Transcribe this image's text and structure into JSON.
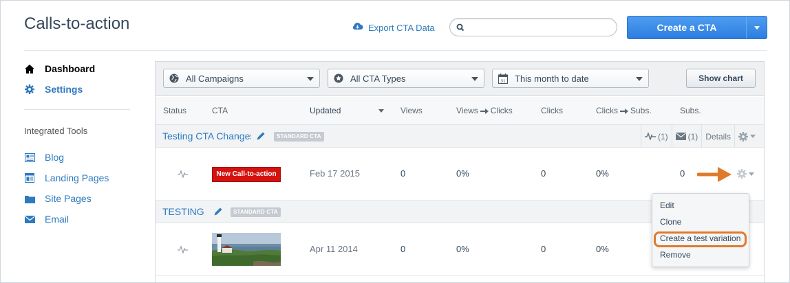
{
  "page": {
    "title": "Calls-to-action"
  },
  "header": {
    "export_label": "Export CTA Data",
    "search": {
      "value": "",
      "placeholder": ""
    },
    "create_label": "Create a CTA"
  },
  "sidebar": {
    "nav": [
      {
        "label": "Dashboard",
        "icon": "home-icon"
      },
      {
        "label": "Settings",
        "icon": "gear-icon"
      }
    ],
    "tools_heading": "Integrated Tools",
    "tools": [
      {
        "label": "Blog",
        "icon": "blog-icon"
      },
      {
        "label": "Landing Pages",
        "icon": "landing-pages-icon"
      },
      {
        "label": "Site Pages",
        "icon": "site-pages-icon"
      },
      {
        "label": "Email",
        "icon": "email-icon"
      }
    ]
  },
  "filters": {
    "campaigns": "All Campaigns",
    "types": "All CTA Types",
    "date": "This month to date",
    "show_chart": "Show chart"
  },
  "table": {
    "columns": [
      "Status",
      "CTA",
      "Updated",
      "Views",
      "Views",
      "Clicks",
      "Clicks",
      "Clicks",
      "Subs.",
      "Subs."
    ],
    "headers": {
      "status": "Status",
      "cta": "CTA",
      "updated": "Updated",
      "views": "Views",
      "views_clicks_a": "Views",
      "views_clicks_b": "Clicks",
      "clicks": "Clicks",
      "clicks_subs_a": "Clicks",
      "clicks_subs_b": "Subs.",
      "subs": "Subs."
    },
    "groups": [
      {
        "name": "Testing CTA Changes",
        "badge": "STANDARD CTA",
        "tests_count": "(1)",
        "emails_count": "(1)",
        "details_label": "Details",
        "row": {
          "cta_text": "New Call-to-action",
          "updated": "Feb 17 2015",
          "views": "0",
          "views_clicks": "0%",
          "clicks": "0",
          "clicks_subs": "0%",
          "subs": "0"
        }
      },
      {
        "name": "TESTING",
        "badge": "STANDARD CTA",
        "row": {
          "cta_text": "",
          "updated": "Apr 11 2014",
          "views": "0",
          "views_clicks": "0%",
          "clicks": "0",
          "clicks_subs": "0%",
          "subs": ""
        }
      }
    ]
  },
  "dropdown_menu": [
    "Edit",
    "Clone",
    "Create a test variation",
    "Remove"
  ],
  "colors": {
    "accent": "#2e7abf",
    "primary_button": "#3a8ce8",
    "cta_red": "#d4130f",
    "highlight": "#e07a2b"
  }
}
